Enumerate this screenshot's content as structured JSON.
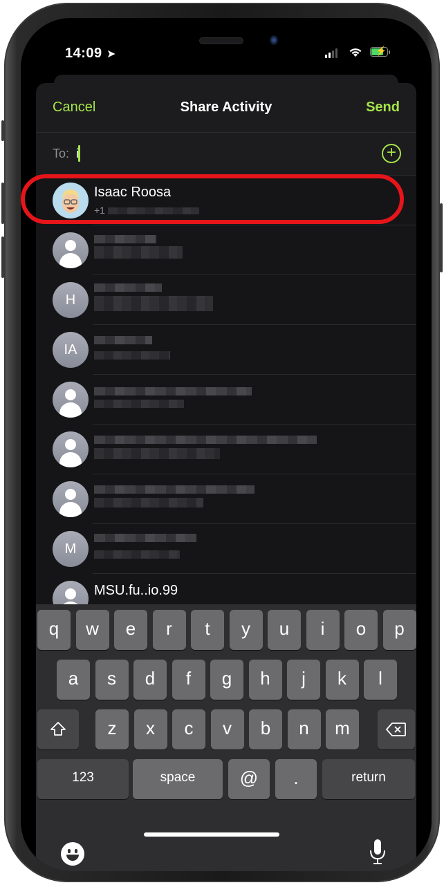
{
  "status_bar": {
    "time": "14:09",
    "location_icon": "location-arrow-icon",
    "signal_icon": "cellular-signal-icon",
    "wifi_icon": "wifi-icon",
    "battery_icon": "battery-charging-icon",
    "battery_color": "#4cd964"
  },
  "nav": {
    "cancel_label": "Cancel",
    "title": "Share Activity",
    "send_label": "Send",
    "accent_color": "#a4e34a"
  },
  "to_field": {
    "label": "To:",
    "value": "i",
    "add_icon": "add-contact-icon"
  },
  "contacts": [
    {
      "name": "Isaac Roosa",
      "subtitle": "+1",
      "avatar": "memoji",
      "highlighted": true
    },
    {
      "name": "",
      "subtitle": "",
      "avatar": "generic"
    },
    {
      "name": "",
      "subtitle": "",
      "avatar": "initials",
      "initials": "H"
    },
    {
      "name": "",
      "subtitle": "",
      "avatar": "initials",
      "initials": "IA"
    },
    {
      "name": "",
      "subtitle": "",
      "avatar": "generic"
    },
    {
      "name": "",
      "subtitle": "",
      "avatar": "generic"
    },
    {
      "name": "",
      "subtitle": "",
      "avatar": "generic"
    },
    {
      "name": "",
      "subtitle": "",
      "avatar": "initials",
      "initials": "M"
    },
    {
      "name": "MSU.fu..io.99",
      "subtitle": "",
      "avatar": "generic"
    }
  ],
  "highlight_color": "#e5151a",
  "keyboard": {
    "row1": [
      "q",
      "w",
      "e",
      "r",
      "t",
      "y",
      "u",
      "i",
      "o",
      "p"
    ],
    "row2": [
      "a",
      "s",
      "d",
      "f",
      "g",
      "h",
      "j",
      "k",
      "l"
    ],
    "row3": [
      "z",
      "x",
      "c",
      "v",
      "b",
      "n",
      "m"
    ],
    "shift_icon": "shift-icon",
    "delete_icon": "delete-backspace-icon",
    "numbers_label": "123",
    "space_label": "space",
    "at_label": "@",
    "period_label": ".",
    "return_label": "return",
    "emoji_icon": "emoji-icon",
    "mic_icon": "microphone-icon"
  }
}
